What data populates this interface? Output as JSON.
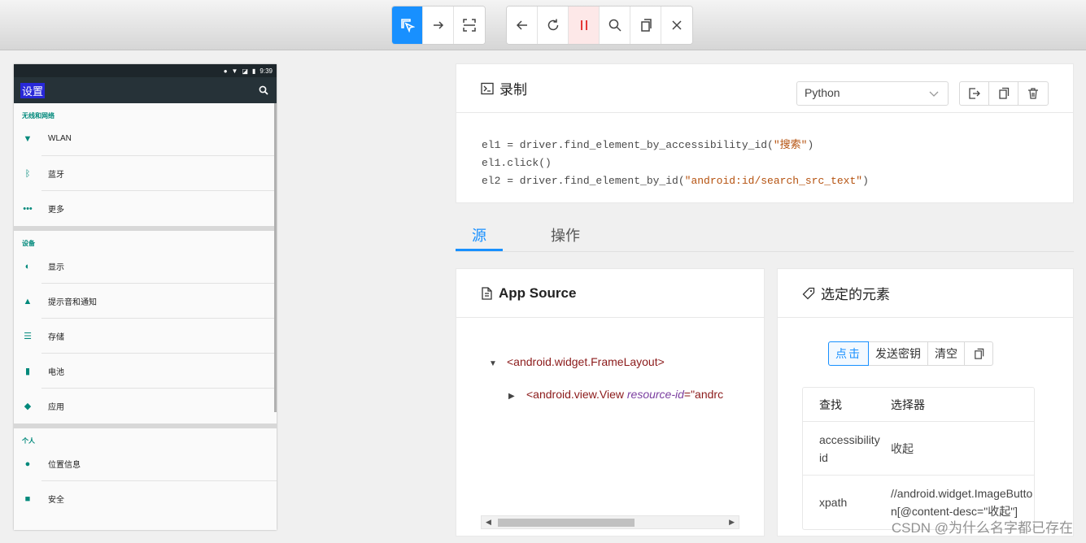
{
  "toolbar": {
    "group1": [
      "select-element",
      "swipe",
      "tap-coordinates"
    ],
    "group2": [
      "back",
      "refresh",
      "pause-recording",
      "search",
      "copy-xml",
      "quit-session"
    ]
  },
  "device": {
    "status_time": "9:39",
    "title": "设置",
    "sections": [
      {
        "header": "无线和网络",
        "items": [
          {
            "label": "WLAN",
            "icon": "wifi-icon"
          },
          {
            "label": "蓝牙",
            "icon": "bluetooth-icon"
          },
          {
            "label": "更多",
            "icon": "more-icon"
          }
        ]
      },
      {
        "header": "设备",
        "items": [
          {
            "label": "显示",
            "icon": "display-icon"
          },
          {
            "label": "提示音和通知",
            "icon": "bell-icon"
          },
          {
            "label": "存储",
            "icon": "storage-icon"
          },
          {
            "label": "电池",
            "icon": "battery-icon"
          },
          {
            "label": "应用",
            "icon": "android-icon"
          }
        ]
      },
      {
        "header": "个人",
        "items": [
          {
            "label": "位置信息",
            "icon": "location-icon"
          },
          {
            "label": "安全",
            "icon": "lock-icon"
          }
        ]
      }
    ]
  },
  "recorder": {
    "title": "录制",
    "language": "Python",
    "code": {
      "l1_pre": "el1 = driver.find_element_by_accessibility_id(",
      "l1_str": "\"搜索\"",
      "l1_post": ")",
      "l2": "el1.click()",
      "l3_pre": "el2 = driver.find_element_by_id(",
      "l3_str": "\"android:id/search_src_text\"",
      "l3_post": ")"
    }
  },
  "tabs": {
    "source": "源",
    "actions": "操作"
  },
  "source": {
    "title": "App Source",
    "node1": "<android.widget.FrameLayout>",
    "node2_tag": "<android.view.View ",
    "node2_attr": "resource-id",
    "node2_eq": "=\"andrc"
  },
  "selected": {
    "title": "选定的元素",
    "btn_tap": "点击",
    "btn_send_keys": "发送密钥",
    "btn_clear": "清空",
    "table_header": {
      "find": "查找",
      "selector": "选择器"
    },
    "rows": [
      {
        "find": "accessibility id",
        "selector": "收起"
      },
      {
        "find": "xpath",
        "selector": "//android.widget.ImageButton[@content-desc=\"收起\"]"
      }
    ]
  },
  "watermark": "CSDN @为什么名字都已存在",
  "colors": {
    "accent": "#1890ff",
    "teal": "#00897b",
    "appbar": "#263238"
  }
}
